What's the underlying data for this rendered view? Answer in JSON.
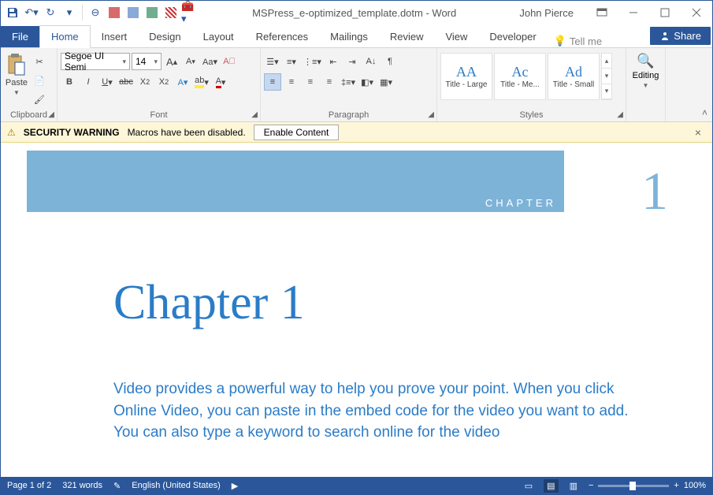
{
  "titlebar": {
    "title": "MSPress_e-optimized_template.dotm - Word",
    "user": "John Pierce"
  },
  "tabs": {
    "file": "File",
    "items": [
      "Home",
      "Insert",
      "Design",
      "Layout",
      "References",
      "Mailings",
      "Review",
      "View",
      "Developer"
    ],
    "tellme": "Tell me",
    "share": "Share"
  },
  "ribbon": {
    "clipboard": {
      "label": "Clipboard",
      "paste": "Paste"
    },
    "font": {
      "label": "Font",
      "name": "Segoe UI Semi",
      "size": "14"
    },
    "paragraph": {
      "label": "Paragraph"
    },
    "styles": {
      "label": "Styles",
      "items": [
        "Title - Large",
        "Title - Me...",
        "Title - Small"
      ],
      "preview": [
        "AA",
        "Ac",
        "Ad"
      ]
    },
    "editing": {
      "label": "Editing"
    }
  },
  "security": {
    "title": "SECURITY WARNING",
    "msg": "Macros have been disabled.",
    "button": "Enable Content"
  },
  "doc": {
    "chapterlabel": "CHAPTER",
    "chapternum": "1",
    "title": "Chapter 1",
    "body": "Video provides a powerful way to help you prove your point. When you click Online Video, you can paste in the embed code for the video you want to add. You can also type a keyword to search online for the video"
  },
  "status": {
    "page": "Page 1 of 2",
    "words": "321 words",
    "lang": "English (United States)",
    "zoom": "100%"
  }
}
